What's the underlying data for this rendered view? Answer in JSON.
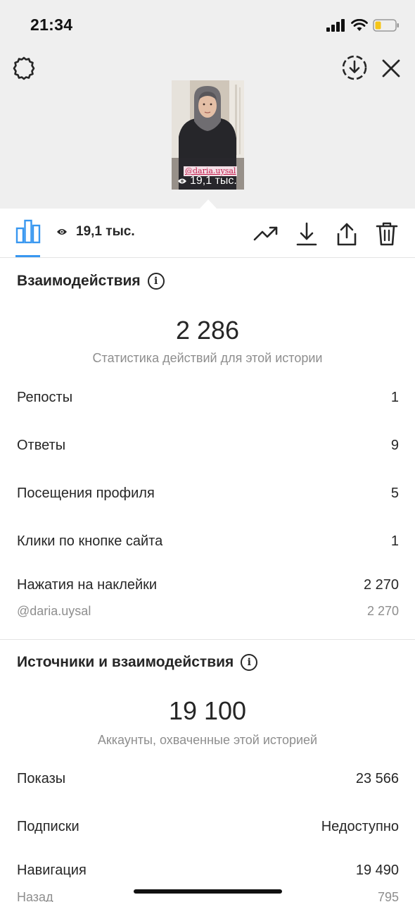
{
  "status_bar": {
    "time": "21:34"
  },
  "story": {
    "mention": "@daria.uysal",
    "views": "19,1 тыс."
  },
  "toolbar": {
    "views": "19,1 тыс."
  },
  "interactions": {
    "title": "Взаимодействия",
    "total": "2 286",
    "caption": "Статистика действий для этой истории",
    "rows": [
      {
        "label": "Репосты",
        "value": "1"
      },
      {
        "label": "Ответы",
        "value": "9"
      },
      {
        "label": "Посещения профиля",
        "value": "5"
      },
      {
        "label": "Клики по кнопке сайта",
        "value": "1"
      },
      {
        "label": "Нажатия на наклейки",
        "value": "2 270"
      }
    ],
    "sticker_sub": {
      "label": "@daria.uysal",
      "value": "2 270"
    }
  },
  "discovery": {
    "title": "Источники и взаимодействия",
    "total": "19 100",
    "caption": "Аккаунты, охваченные этой историей",
    "rows": [
      {
        "label": "Показы",
        "value": "23 566"
      },
      {
        "label": "Подписки",
        "value": "Недоступно"
      },
      {
        "label": "Навигация",
        "value": "19 490"
      }
    ],
    "nav_sub": {
      "label": "Назад",
      "value": "795"
    }
  },
  "icons": {
    "settings": "settings-gear-icon",
    "save": "save-download-circle-icon",
    "close": "close-x-icon",
    "insights": "bar-chart-icon",
    "views": "eye-icon",
    "promote": "trending-up-icon",
    "download": "download-icon",
    "share": "share-icon",
    "delete": "trash-icon",
    "info": "info-icon"
  },
  "colors": {
    "accent": "#3897f0",
    "top_background": "#efefef",
    "secondary_text": "#8e8e8e"
  }
}
